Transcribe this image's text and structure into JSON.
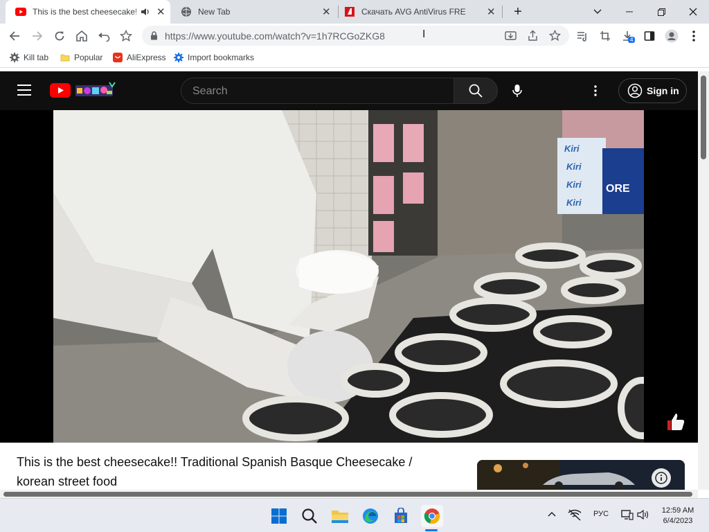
{
  "browser": {
    "tabs": [
      {
        "title": "This is the best cheesecake!! Traditional Spanish Basque Cheesecake / korean street food",
        "favicon": "youtube-icon",
        "active": true,
        "audio": true
      },
      {
        "title": "New Tab",
        "favicon": "globe-icon",
        "active": false
      },
      {
        "title": "Скачать AVG AntiVirus FREE",
        "favicon": "avg-icon",
        "active": false
      }
    ],
    "new_tab_icon": "plus-icon",
    "window_controls": [
      "minimize-icon",
      "maximize-icon",
      "close-icon"
    ]
  },
  "toolbar": {
    "url": "https://www.youtube.com/watch?v=1h7RCGoZKG8",
    "download_badge": "4"
  },
  "bookmarks": [
    {
      "label": "Kill tab",
      "icon": "gear-icon"
    },
    {
      "label": "Popular",
      "icon": "folder-icon"
    },
    {
      "label": "AliExpress",
      "icon": "aliexpress-icon"
    },
    {
      "label": "Import bookmarks",
      "icon": "gear-blue-icon"
    }
  ],
  "youtube": {
    "search_placeholder": "Search",
    "sign_in_label": "Sign in",
    "video_title": "This is the best cheesecake!! Traditional Spanish Basque Cheesecake / korean street food",
    "frame_labels": {
      "kiri": "Kiri",
      "oreo": "ORE"
    }
  },
  "taskbar": {
    "language": "РУС",
    "time": "12:59 AM",
    "date": "6/4/2023"
  },
  "colors": {
    "youtube_red": "#ff0000",
    "accent_blue": "#1a73e8",
    "tab_bg": "#dee1e6",
    "page_bg": "#0f0f0f"
  }
}
